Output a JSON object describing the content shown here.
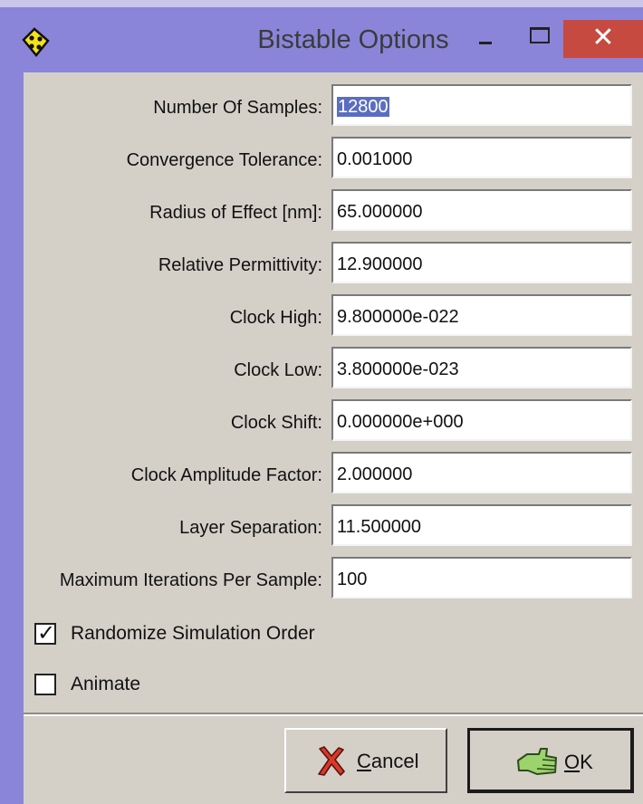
{
  "window": {
    "title": "Bistable Options",
    "minimize_symbol": "–",
    "maximize_symbol": "□",
    "close_symbol": "✕"
  },
  "fields": [
    {
      "label": "Number Of Samples:",
      "value": "12800",
      "selected": true
    },
    {
      "label": "Convergence Tolerance:",
      "value": "0.001000"
    },
    {
      "label": "Radius of Effect [nm]:",
      "value": "65.000000"
    },
    {
      "label": "Relative Permittivity:",
      "value": "12.900000"
    },
    {
      "label": "Clock High:",
      "value": "9.800000e-022"
    },
    {
      "label": "Clock Low:",
      "value": "3.800000e-023"
    },
    {
      "label": "Clock Shift:",
      "value": "0.000000e+000"
    },
    {
      "label": "Clock Amplitude Factor:",
      "value": "2.000000"
    },
    {
      "label": "Layer Separation:",
      "value": "11.500000"
    },
    {
      "label": "Maximum Iterations Per Sample:",
      "value": "100"
    }
  ],
  "checkboxes": [
    {
      "label": "Randomize Simulation Order",
      "checked": true
    },
    {
      "label": "Animate",
      "checked": false
    }
  ],
  "buttons": {
    "cancel": {
      "mnemonic": "C",
      "rest": "ancel",
      "icon": "red-x-icon"
    },
    "ok": {
      "mnemonic": "O",
      "rest": "K",
      "icon": "hand-ok-icon"
    }
  },
  "colors": {
    "titlebar": "#8a85d9",
    "close": "#c74a40",
    "client": "#d4d0c8",
    "selection": "#5a6ec0"
  }
}
